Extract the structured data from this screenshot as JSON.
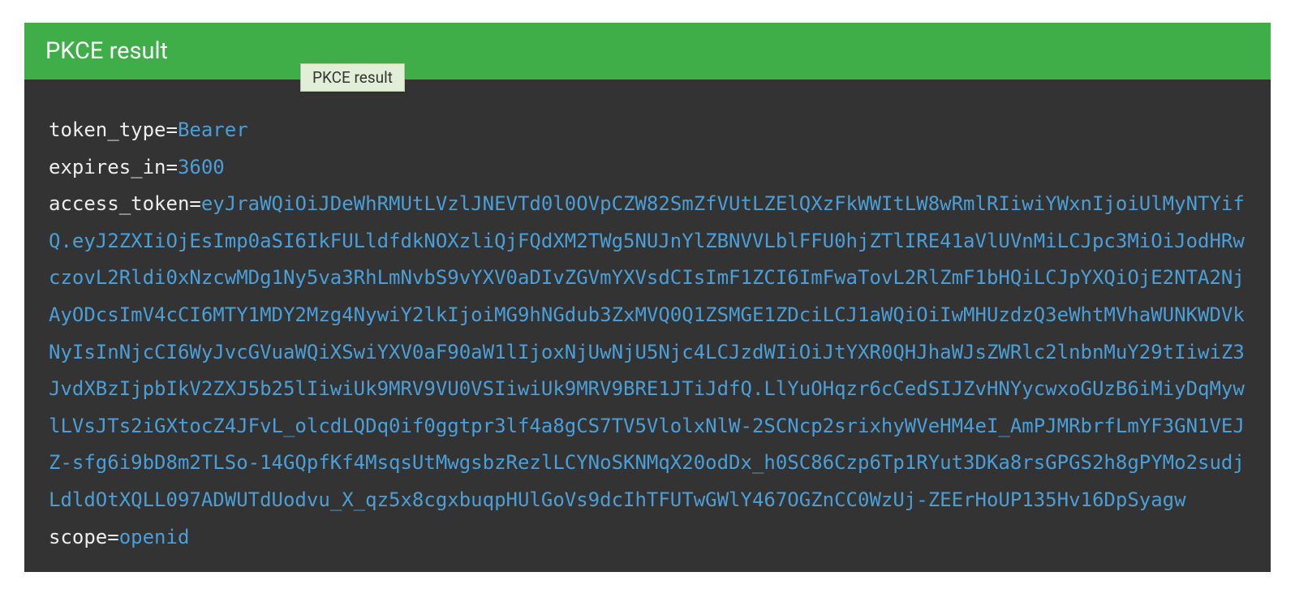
{
  "header": {
    "title": "PKCE result",
    "tooltip": "PKCE result"
  },
  "result": {
    "rows": [
      {
        "key": "token_type",
        "value": "Bearer"
      },
      {
        "key": "expires_in",
        "value": "3600"
      },
      {
        "key": "access_token",
        "value": "eyJraWQiOiJDeWhRMUtLVzlJNEVTd0l0OVpCZW82SmZfVUtLZElQXzFkWWItLW8wRmlRIiwiYWxnIjoiUlMyNTYifQ.eyJ2ZXIiOjEsImp0aSI6IkFULldfdkNOXzliQjFQdXM2TWg5NUJnYlZBNVVLblFFU0hjZTlIRE41aVlUVnMiLCJpc3MiOiJodHRwczovL2Rldi0xNzcwMDg1Ny5va3RhLmNvbS9vYXV0aDIvZGVmYXVsdCIsImF1ZCI6ImFwaTovL2RlZmF1bHQiLCJpYXQiOjE2NTA2NjAyODcsImV4cCI6MTY1MDY2Mzg4NywiY2lkIjoiMG9hNGdub3ZxMVQ0Q1ZSMGE1ZDciLCJ1aWQiOiIwMHUzdzQ3eWhtMVhaWUNKWDVkNyIsInNjcCI6WyJvcGVuaWQiXSwiYXV0aF90aW1lIjoxNjUwNjU5Njc4LCJzdWIiOiJtYXR0QHJhaWJsZWRlc2lnbnMuY29tIiwiZ3JvdXBzIjpbIkV2ZXJ5b25lIiwiUk9MRV9VU0VSIiwiUk9MRV9BRE1JTiJdfQ.LlYuOHqzr6cCedSIJZvHNYycwxoGUzB6iMiyDqMywlLVsJTs2iGXtocZ4JFvL_olcdLQDq0if0ggtpr3lf4a8gCS7TV5VlolxNlW-2SCNcp2srixhyWVeHM4eI_AmPJMRbrfLmYF3GN1VEJZ-sfg6i9bD8m2TLSo-14GQpfKf4MsqsUtMwgsbzRezlLCYNoSKNMqX20odDx_h0SC86Czp6Tp1RYut3DKa8rsGPGS2h8gPYMo2sudjLdldOtXQLL097ADWUTdUodvu_X_qz5x8cgxbuqpHUlGoVs9dcIhTFUTwGWlY467OGZnCC0WzUj-ZEErHoUP135Hv16DpSyagw"
      },
      {
        "key": "scope",
        "value": "openid"
      }
    ]
  }
}
